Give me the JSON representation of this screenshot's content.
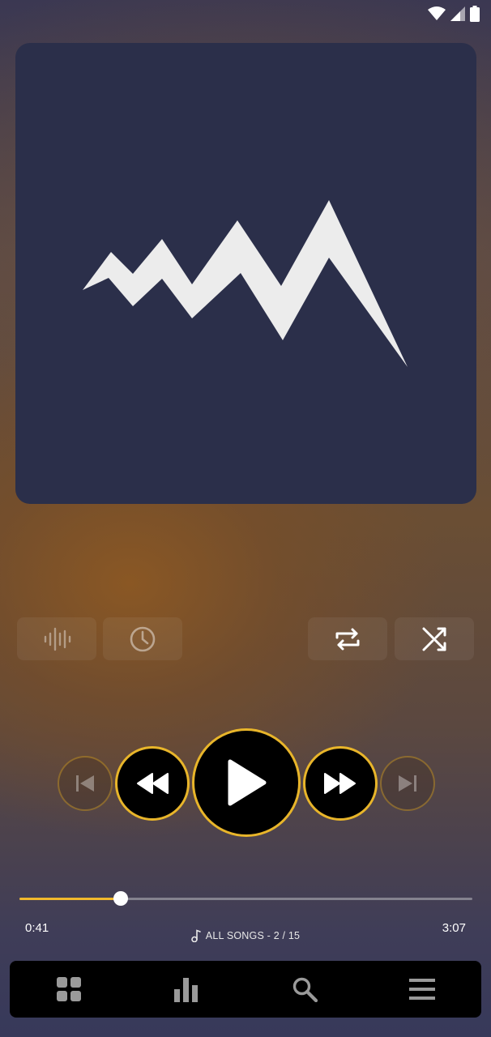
{
  "status_bar": {
    "icons": [
      "wifi-icon",
      "cellular-signal-icon",
      "battery-icon"
    ]
  },
  "album_art": {
    "icon": "waveform-logo-icon",
    "background": "#2b2f4a"
  },
  "action_row": [
    {
      "icon": "equalizer-waveform-icon",
      "enabled": false
    },
    {
      "icon": "sleep-timer-clock-icon",
      "enabled": false
    },
    {
      "icon": "repeat-icon",
      "enabled": true
    },
    {
      "icon": "shuffle-icon",
      "enabled": true
    }
  ],
  "playback": {
    "state": "paused",
    "accent": "#e8b52a",
    "controls": [
      "skip-previous-icon",
      "rewind-icon",
      "play-icon",
      "fast-forward-icon",
      "skip-next-icon"
    ]
  },
  "progress": {
    "elapsed": "0:41",
    "duration": "3:07",
    "fraction": 0.223
  },
  "queue": {
    "label": "ALL SONGS - 2 / 15"
  },
  "bottom_nav": [
    "grid-icon",
    "bar-chart-icon",
    "search-icon",
    "menu-icon"
  ]
}
